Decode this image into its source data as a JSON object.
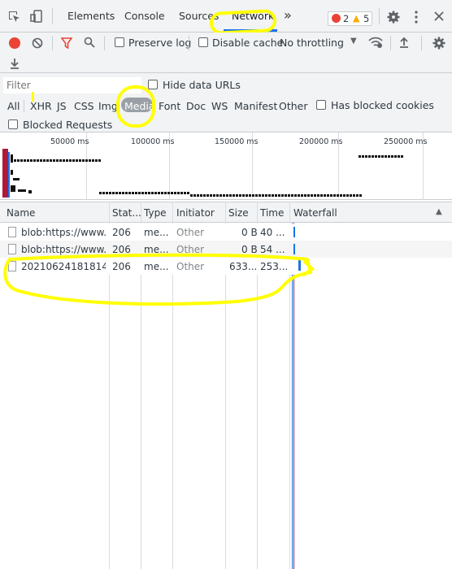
{
  "tabs": {
    "elements": "Elements",
    "console": "Console",
    "sources": "Sources",
    "network": "Network",
    "more": "»"
  },
  "status": {
    "errors": "2",
    "warnings": "5"
  },
  "toolbar": {
    "preserve_log": "Preserve log",
    "disable_cache": "Disable cache",
    "throttling": "No throttling"
  },
  "filter": {
    "placeholder": "Filter",
    "hide_data_urls": "Hide data URLs",
    "types": [
      "All",
      "XHR",
      "JS",
      "CSS",
      "Img",
      "Media",
      "Font",
      "Doc",
      "WS",
      "Manifest",
      "Other"
    ],
    "has_blocked_cookies": "Has blocked cookies",
    "blocked_requests": "Blocked Requests"
  },
  "overview": {
    "ticks": [
      "50000 ms",
      "100000 ms",
      "150000 ms",
      "200000 ms",
      "250000 ms"
    ]
  },
  "table": {
    "headers": [
      "Name",
      "Stat...",
      "Type",
      "Initiator",
      "Size",
      "Time",
      "Waterfall"
    ],
    "rows": [
      {
        "name": "blob:https://www....",
        "status": "206",
        "type": "me...",
        "initiator": "Other",
        "size": "0 B",
        "time": "40 ..."
      },
      {
        "name": "blob:https://www....",
        "status": "206",
        "type": "me...",
        "initiator": "Other",
        "size": "0 B",
        "time": "54 ..."
      },
      {
        "name": "20210624181814....",
        "status": "206",
        "type": "me...",
        "initiator": "Other",
        "size": "633...",
        "time": "253..."
      }
    ]
  },
  "colors": {
    "highlight": "#ffff00",
    "record": "#ea4335",
    "media_bg": "#9aa0a6",
    "waterfall_blue": "#1a73e8"
  }
}
